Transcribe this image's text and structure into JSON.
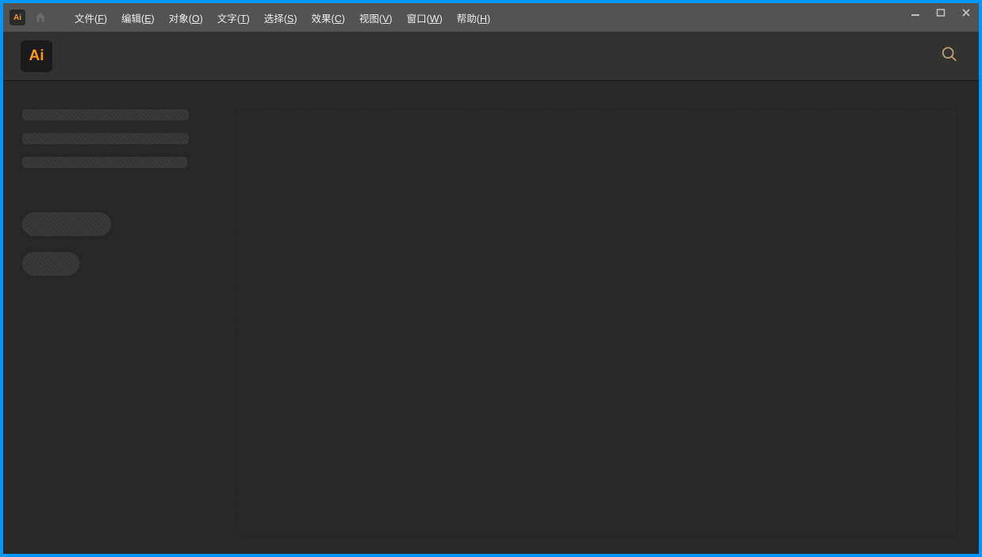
{
  "app": {
    "icon_text": "Ai",
    "logo_text": "Ai"
  },
  "menubar": {
    "items": [
      {
        "label": "文件",
        "key": "F"
      },
      {
        "label": "编辑",
        "key": "E"
      },
      {
        "label": "对象",
        "key": "O"
      },
      {
        "label": "文字",
        "key": "T"
      },
      {
        "label": "选择",
        "key": "S"
      },
      {
        "label": "效果",
        "key": "C"
      },
      {
        "label": "视图",
        "key": "V"
      },
      {
        "label": "窗口",
        "key": "W"
      },
      {
        "label": "帮助",
        "key": "H"
      }
    ]
  }
}
